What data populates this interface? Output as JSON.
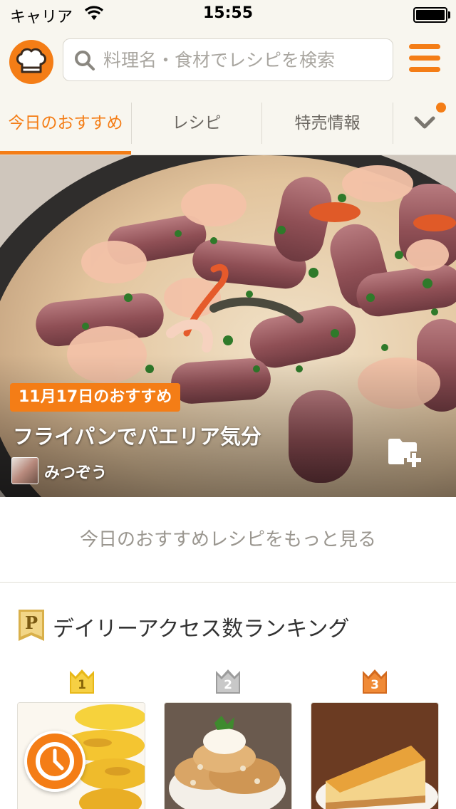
{
  "status_bar": {
    "carrier": "キャリア",
    "time": "15:55",
    "battery_level": 1.0
  },
  "header": {
    "logo_icon": "chef-hat-icon",
    "search": {
      "placeholder": "料理名・食材でレシピを検索",
      "value": ""
    },
    "menu_icon": "hamburger-menu-icon"
  },
  "tabs": {
    "items": [
      {
        "label": "今日のおすすめ",
        "active": true
      },
      {
        "label": "レシピ",
        "active": false
      },
      {
        "label": "特売情報",
        "active": false
      }
    ],
    "more_icon": "chevron-down-icon",
    "has_notification": true
  },
  "hero": {
    "date_badge": "11月17日のおすすめ",
    "title": "フライパンでパエリア気分",
    "author": "みつぞう",
    "save_icon": "folder-plus-icon"
  },
  "more_recommendations": "今日のおすすめレシピをもっと見る",
  "ranking": {
    "title": "デイリーアクセス数ランキング",
    "icon": "premium-p-icon",
    "items": [
      {
        "rank": "1",
        "crown_color": "#e8b818",
        "image": "grilled-sweet-potato"
      },
      {
        "rank": "2",
        "crown_color": "#a9a9a9",
        "image": "pancakes"
      },
      {
        "rank": "3",
        "crown_color": "#e07a2a",
        "image": "cheesecake"
      }
    ]
  },
  "timer_icon": "clock-icon",
  "colors": {
    "accent": "#f47d16",
    "header_bg": "#f8f6ef",
    "muted_text": "#9a968f"
  }
}
